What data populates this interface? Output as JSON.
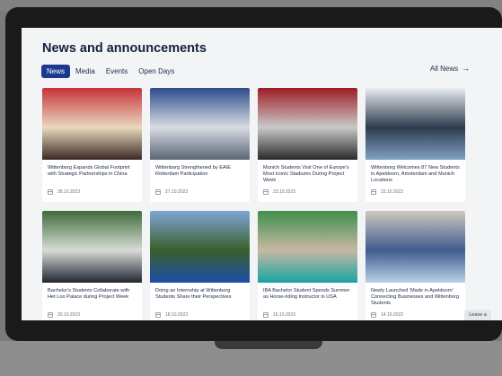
{
  "page": {
    "heading": "News and announcements",
    "all_news_label": "All News",
    "arrow_icon": "arrow-right-icon",
    "leave_label": "Leave a"
  },
  "tabs": [
    {
      "label": "News",
      "active": true
    },
    {
      "label": "Media",
      "active": false
    },
    {
      "label": "Events",
      "active": false
    },
    {
      "label": "Open Days",
      "active": false
    }
  ],
  "cards": [
    {
      "title": "Wittenborg Expands Global Footprint with Strategic Partnerships in China",
      "date": "28.10.2023",
      "photo": "delegation-meeting-photo",
      "colors": [
        "#c7323a",
        "#e9d9bf",
        "#3b2a24"
      ]
    },
    {
      "title": "Wittenborg Strengthened by EAIE Rotterdam Participation",
      "date": "27.10.2023",
      "photo": "conference-booth-photo",
      "colors": [
        "#2b4c8a",
        "#d9dde3",
        "#5a6475"
      ]
    },
    {
      "title": "Munich Students Visit One of Europe's Most Iconic Stadiums During Project Week",
      "date": "23.10.2023",
      "photo": "stadium-group-photo",
      "colors": [
        "#9e1d25",
        "#c9c9c9",
        "#2a2a2a"
      ]
    },
    {
      "title": "Wittenborg Welcomes 87 New Students in Apeldoorn, Amsterdam and Munich Locations",
      "date": "22.10.2023",
      "photo": "students-group-photo",
      "colors": [
        "#e9edf2",
        "#2e3b4e",
        "#7fa1c2"
      ]
    },
    {
      "title": "Bachelor's Students Collaborate with Het Loo Palace during Project Week",
      "date": "20.10.2023",
      "photo": "palace-students-photo",
      "colors": [
        "#3f6b3a",
        "#d8dcd6",
        "#1f2630"
      ]
    },
    {
      "title": "Doing an Internship at Wittenborg Students Share their Perspectives",
      "date": "18.10.2023",
      "photo": "campus-building-photo",
      "colors": [
        "#7fa6d6",
        "#3a5f2c",
        "#1c4fa8"
      ]
    },
    {
      "title": "IBA Bachelor Student Spends Summer as Horse-riding Instructor in USA",
      "date": "16.10.2023",
      "photo": "horse-rider-photo",
      "colors": [
        "#3f8f4c",
        "#c7b8a3",
        "#1aa3a3"
      ]
    },
    {
      "title": "Newly Launched 'Made in Apeldoorn' Connecting Businesses and Wittenborg Students",
      "date": "14.10.2023",
      "photo": "award-group-photo",
      "colors": [
        "#cfc8c0",
        "#3f5d8f",
        "#b8d0e6"
      ]
    }
  ]
}
